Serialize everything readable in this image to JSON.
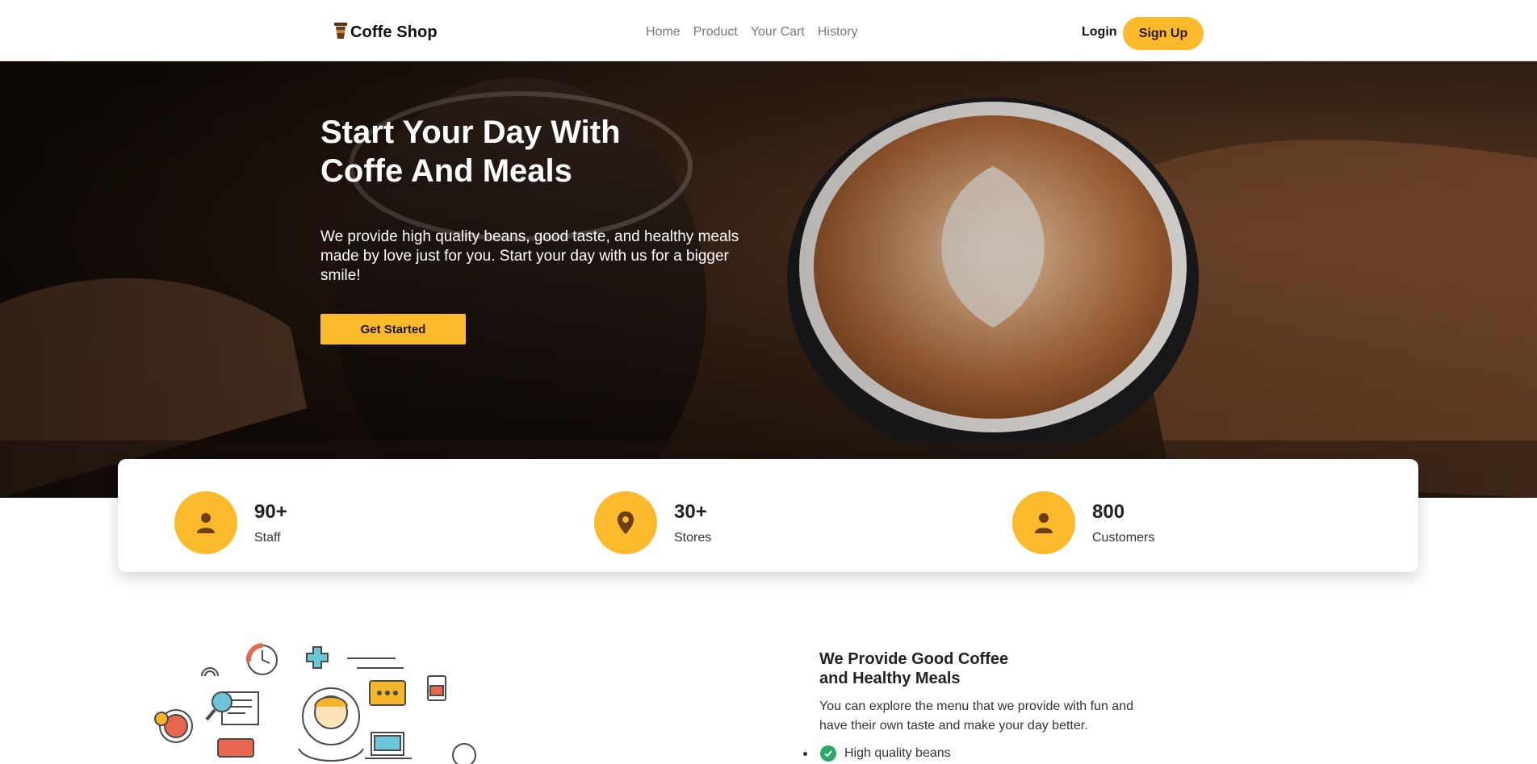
{
  "navbar": {
    "brand": "Coffe Shop",
    "brand_icon": "coffee-cup-icon",
    "links": [
      "Home",
      "Product",
      "Your Cart",
      "History"
    ],
    "login_label": "Login",
    "signup_label": "Sign Up"
  },
  "hero": {
    "title_line1": "Start Your Day With",
    "title_line2": "Coffe And Meals",
    "description": "We provide high quality beans, good taste, and healthy meals made by love just for you. Start your day with us for a bigger smile!",
    "cta_label": "Get Started"
  },
  "stats": [
    {
      "value": "90+",
      "label": "Staff",
      "icon": "user-icon"
    },
    {
      "value": "30+",
      "label": "Stores",
      "icon": "location-pin-icon"
    },
    {
      "value": "800",
      "label": "Customers",
      "icon": "user-icon"
    }
  ],
  "feature": {
    "title_line1": "We Provide Good Coffee",
    "title_line2": "and Healthy Meals",
    "description": "You can explore the menu that we provide with fun and have their own taste and make your day better.",
    "items": [
      "High quality beans"
    ]
  },
  "colors": {
    "accent": "#fbb92c",
    "icon_brown": "#6b3e14",
    "check_green": "#2ba76a"
  }
}
